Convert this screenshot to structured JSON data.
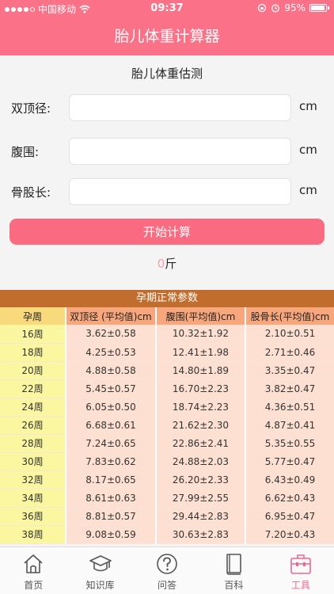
{
  "status_bar": {
    "carrier": "中国移动",
    "time": "09:37",
    "battery": "95%"
  },
  "nav": {
    "title": "胎儿体重计算器"
  },
  "form": {
    "title": "胎儿体重估测",
    "fields": [
      {
        "label": "双顶径:",
        "unit": "cm",
        "value": "",
        "placeholder": ""
      },
      {
        "label": "腹围:",
        "unit": "cm",
        "value": "",
        "placeholder": ""
      },
      {
        "label": "骨股长:",
        "unit": "cm",
        "value": "",
        "placeholder": ""
      }
    ],
    "button_label": "开始计算",
    "result_value": "0",
    "result_unit": "斤"
  },
  "table": {
    "title": "孕期正常参数",
    "headers": [
      "孕周",
      "双顶径 (平均值)cm",
      "腹围(平均值)cm",
      "股骨长(平均值)cm"
    ],
    "rows": [
      [
        "16周",
        "3.62±0.58",
        "10.32±1.92",
        "2.10±0.51"
      ],
      [
        "18周",
        "4.25±0.53",
        "12.41±1.98",
        "2.71±0.46"
      ],
      [
        "20周",
        "4.88±0.58",
        "14.80±1.89",
        "3.35±0.47"
      ],
      [
        "22周",
        "5.45±0.57",
        "16.70±2.23",
        "3.82±0.47"
      ],
      [
        "24周",
        "6.05±0.50",
        "18.74±2.23",
        "4.36±0.51"
      ],
      [
        "26周",
        "6.68±0.61",
        "21.62±2.30",
        "4.87±0.41"
      ],
      [
        "28周",
        "7.24±0.65",
        "22.86±2.41",
        "5.35±0.55"
      ],
      [
        "30周",
        "7.83±0.62",
        "24.88±2.03",
        "5.77±0.47"
      ],
      [
        "32周",
        "8.17±0.65",
        "26.20±2.33",
        "6.43±0.49"
      ],
      [
        "34周",
        "8.61±0.63",
        "27.99±2.55",
        "6.62±0.43"
      ],
      [
        "36周",
        "8.81±0.57",
        "29.44±2.83",
        "6.95±0.47"
      ],
      [
        "38周",
        "9.08±0.59",
        "30.63±2.83",
        "7.20±0.43"
      ]
    ]
  },
  "tabs": [
    {
      "label": "首页",
      "icon": "home-icon"
    },
    {
      "label": "知识库",
      "icon": "graduation-cap-icon"
    },
    {
      "label": "问答",
      "icon": "question-icon"
    },
    {
      "label": "百科",
      "icon": "book-icon"
    },
    {
      "label": "工具",
      "icon": "toolbox-icon",
      "active": true
    }
  ],
  "colors": {
    "brand": "#fb7288",
    "button": "#fa6a80",
    "table_title": "#c06d2d",
    "active_tab": "#f0668b"
  }
}
